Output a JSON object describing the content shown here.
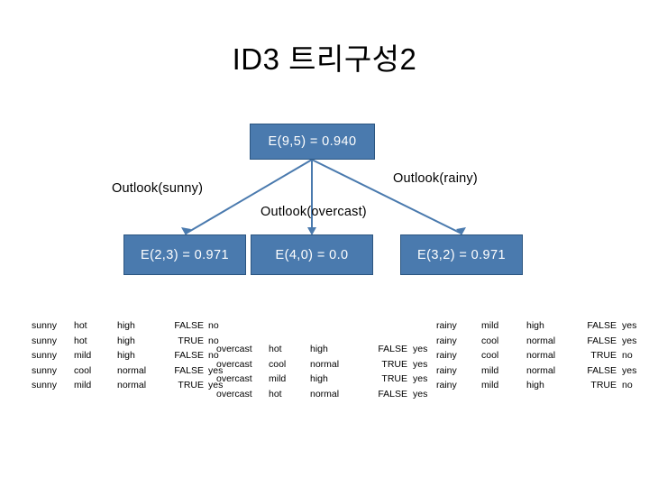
{
  "slide": {
    "title": "ID3 트리구성2",
    "background": "#ffffff",
    "node_fill": "#4a7aae",
    "node_border": "#2b5580",
    "node_text": "#ffffff",
    "connector_color": "#4a7aae"
  },
  "tree": {
    "root": {
      "label": "E(9,5) = 0.940"
    },
    "edges": [
      {
        "label": "Outlook(sunny)"
      },
      {
        "label": "Outlook(overcast)"
      },
      {
        "label": "Outlook(rainy)"
      }
    ],
    "children": [
      {
        "label": "E(2,3) = 0.971"
      },
      {
        "label": "E(4,0) = 0.0"
      },
      {
        "label": "E(3,2) = 0.971"
      }
    ]
  },
  "tables": {
    "sunny": {
      "rows": [
        [
          "sunny",
          "hot",
          "high",
          "FALSE",
          "no"
        ],
        [
          "sunny",
          "hot",
          "high",
          "TRUE",
          "no"
        ],
        [
          "sunny",
          "mild",
          "high",
          "FALSE",
          "no"
        ],
        [
          "sunny",
          "cool",
          "normal",
          "FALSE",
          "yes"
        ],
        [
          "sunny",
          "mild",
          "normal",
          "TRUE",
          "yes"
        ]
      ]
    },
    "overcast": {
      "rows": [
        [
          "overcast",
          "hot",
          "high",
          "FALSE",
          "yes"
        ],
        [
          "overcast",
          "cool",
          "normal",
          "TRUE",
          "yes"
        ],
        [
          "overcast",
          "mild",
          "high",
          "TRUE",
          "yes"
        ],
        [
          "overcast",
          "hot",
          "normal",
          "FALSE",
          "yes"
        ]
      ]
    },
    "rainy": {
      "rows": [
        [
          "rainy",
          "mild",
          "high",
          "FALSE",
          "yes"
        ],
        [
          "rainy",
          "cool",
          "normal",
          "FALSE",
          "yes"
        ],
        [
          "rainy",
          "cool",
          "normal",
          "TRUE",
          "no"
        ],
        [
          "rainy",
          "mild",
          "normal",
          "FALSE",
          "yes"
        ],
        [
          "rainy",
          "mild",
          "high",
          "TRUE",
          "no"
        ]
      ]
    }
  }
}
